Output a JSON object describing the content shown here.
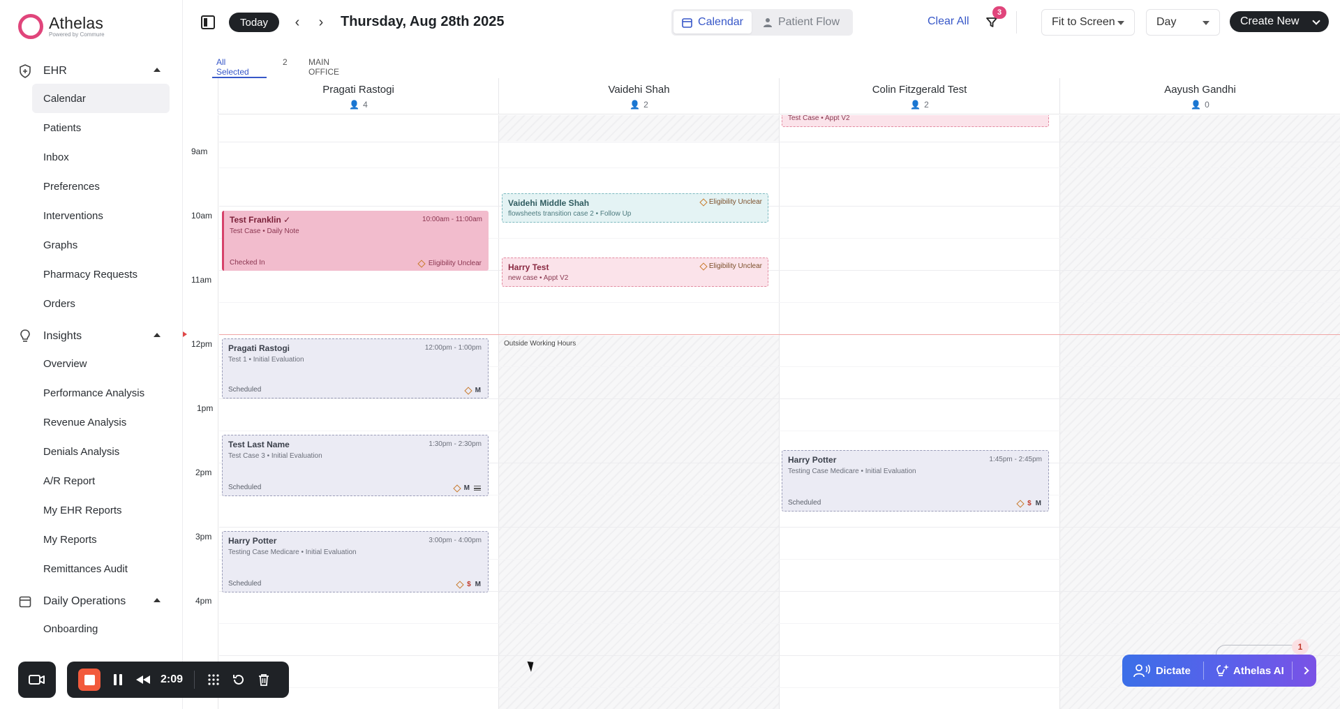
{
  "brand": {
    "name": "Athelas",
    "sub": "Powered by Commure"
  },
  "sidebar": {
    "sections": [
      {
        "label": "EHR",
        "icon": "shield-icon",
        "items": [
          "Calendar",
          "Patients",
          "Inbox",
          "Preferences",
          "Interventions",
          "Graphs",
          "Pharmacy Requests",
          "Orders"
        ]
      },
      {
        "label": "Insights",
        "icon": "lightbulb-icon",
        "items": [
          "Overview",
          "Performance Analysis",
          "Revenue Analysis",
          "Denials Analysis",
          "A/R Report",
          "My EHR Reports",
          "My Reports",
          "Remittances Audit"
        ]
      },
      {
        "label": "Daily Operations",
        "icon": "calendar-icon",
        "items": [
          "Onboarding"
        ]
      }
    ],
    "active_item": "Calendar"
  },
  "topbar": {
    "today_label": "Today",
    "date_title": "Thursday, Aug 28th 2025",
    "view_calendar": "Calendar",
    "view_patient_flow": "Patient Flow",
    "clear_all": "Clear All",
    "filter_count": "3",
    "fit_label": "Fit to Screen",
    "range_label": "Day",
    "create_label": "Create New"
  },
  "location_tabs": {
    "all": "All Selected",
    "count": "2",
    "office": "MAIN OFFICE"
  },
  "calendar": {
    "time_labels": [
      "9am",
      "10am",
      "11am",
      "12pm",
      "1pm",
      "2pm",
      "3pm",
      "4pm"
    ],
    "outside_label": "Outside Working Hours",
    "columns": [
      {
        "name": "Pragati Rastogi",
        "count": "4"
      },
      {
        "name": "Vaidehi Shah",
        "count": "2"
      },
      {
        "name": "Colin Fitzgerald Test",
        "count": "2"
      },
      {
        "name": "Aayush Gandhi",
        "count": "0"
      }
    ],
    "events": {
      "franklin": {
        "title": "Test Franklin",
        "sub": "Test Case • Daily Note",
        "time": "10:00am - 11:00am",
        "status": "Checked In",
        "elig": "Eligibility Unclear"
      },
      "pragati": {
        "title": "Pragati Rastogi",
        "sub": "Test 1 • Initial Evaluation",
        "time": "12:00pm - 1:00pm",
        "status": "Scheduled",
        "flag": "M"
      },
      "lastname": {
        "title": "Test Last Name",
        "sub": "Test Case 3 • Initial Evaluation",
        "time": "1:30pm - 2:30pm",
        "status": "Scheduled",
        "flag": "M"
      },
      "potter1": {
        "title": "Harry Potter",
        "sub": "Testing Case Medicare • Initial Evaluation",
        "time": "3:00pm - 4:00pm",
        "status": "Scheduled",
        "dollar": "$",
        "flag": "M"
      },
      "vaidehi": {
        "title": "Vaidehi Middle Shah",
        "sub": "flowsheets transition case 2 • Follow Up",
        "elig": "Eligibility Unclear"
      },
      "harrytest": {
        "title": "Harry Test",
        "sub": "new case • Appt V2",
        "elig": "Eligibility Unclear"
      },
      "colin_top": {
        "sub": "Test Case • Appt V2"
      },
      "potter2": {
        "title": "Harry Potter",
        "sub": "Testing Case Medicare • Initial Evaluation",
        "time": "1:45pm - 2:45pm",
        "status": "Scheduled",
        "dollar": "$",
        "flag": "M"
      }
    }
  },
  "recorder": {
    "time": "2:09"
  },
  "ai": {
    "dictate": "Dictate",
    "athelas_ai": "Athelas AI",
    "badge": "1"
  }
}
